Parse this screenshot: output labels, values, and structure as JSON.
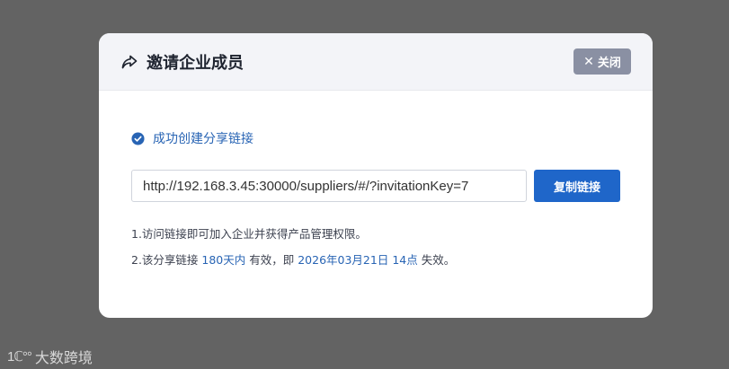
{
  "dialog": {
    "title": "邀请企业成员",
    "close_label": "关闭",
    "close_icon": "close-icon",
    "title_icon": "share-icon"
  },
  "status": {
    "text": "成功创建分享链接",
    "icon": "check-circle-icon"
  },
  "link": {
    "value": "http://192.168.3.45:30000/suppliers/#/?invitationKey=7",
    "copy_label": "复制链接"
  },
  "notes": {
    "line1": "1.访问链接即可加入企业并获得产品管理权限。",
    "line2_prefix": "2.该分享链接 ",
    "line2_duration": "180天内",
    "line2_mid": " 有效，即 ",
    "line2_expiry": "2026年03月21日 14点",
    "line2_suffix": " 失效。"
  },
  "watermark": {
    "logo": "1ℂ°°",
    "text": "大数跨境"
  },
  "colors": {
    "backdrop": "#636363",
    "accent": "#1f66c9",
    "link_text": "#2864b4",
    "close_button": "#8a90a3"
  }
}
